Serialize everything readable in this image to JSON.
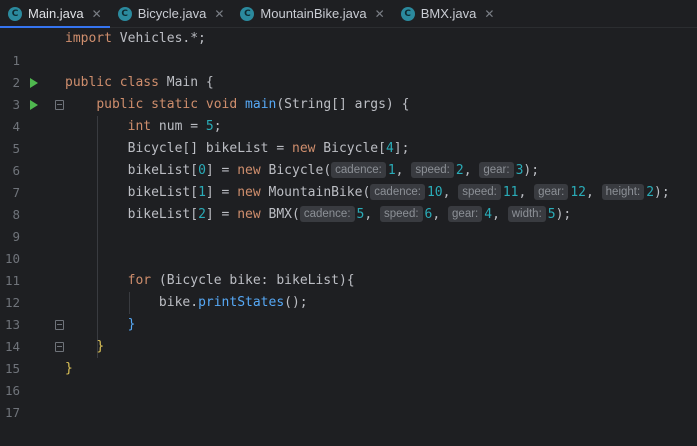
{
  "tabs": [
    {
      "name": "Main.java",
      "icon": "C",
      "active": true
    },
    {
      "name": "Bicycle.java",
      "icon": "C",
      "active": false
    },
    {
      "name": "MountainBike.java",
      "icon": "C",
      "active": false
    },
    {
      "name": "BMX.java",
      "icon": "C",
      "active": false
    }
  ],
  "close_glyph": "✕",
  "line_numbers": [
    "1",
    "2",
    "3",
    "4",
    "5",
    "6",
    "7",
    "8",
    "9",
    "10",
    "11",
    "12",
    "13",
    "14",
    "15",
    "16",
    "17"
  ],
  "code": {
    "l1": {
      "kw": "import",
      "rest": " Vehicles.*;"
    },
    "l3": {
      "kw1": "public",
      "kw2": "class",
      "rest": " Main {"
    },
    "l4": {
      "kw1": "public",
      "kw2": "static",
      "kw3": "void",
      "fn": "main",
      "rest": "(String[] args) {"
    },
    "l5": {
      "kw": "int",
      "mid": " num = ",
      "num": "5",
      "end": ";"
    },
    "l6": {
      "a": "Bicycle[] bikeList = ",
      "kw": "new",
      "b": " Bicycle[",
      "num": "4",
      "c": "];"
    },
    "l7": {
      "a": "bikeList[",
      "idx": "0",
      "b": "] = ",
      "kw": "new",
      "c": " Bicycle(",
      "h1": "cadence:",
      "v1": "1",
      "h2": "speed:",
      "v2": "2",
      "h3": "gear:",
      "v3": "3",
      "end": ");"
    },
    "l8": {
      "a": "bikeList[",
      "idx": "1",
      "b": "] = ",
      "kw": "new",
      "c": " MountainBike(",
      "h1": "cadence:",
      "v1": "10",
      "h2": "speed:",
      "v2": "11",
      "h3": "gear:",
      "v3": "12",
      "h4": "height:",
      "v4": "2",
      "end": ");"
    },
    "l9": {
      "a": "bikeList[",
      "idx": "2",
      "b": "] = ",
      "kw": "new",
      "c": " BMX(",
      "h1": "cadence:",
      "v1": "5",
      "h2": "speed:",
      "v2": "6",
      "h3": "gear:",
      "v3": "4",
      "h4": "width:",
      "v4": "5",
      "end": ");"
    },
    "l12": {
      "kw": "for",
      "rest": " (Bicycle bike: bikeList){"
    },
    "l13": {
      "a": "bike.",
      "fn": "printStates",
      "b": "();"
    },
    "l14": {
      "brace": "}"
    },
    "l15": {
      "brace": "}"
    },
    "l16": {
      "brace": "}"
    }
  }
}
